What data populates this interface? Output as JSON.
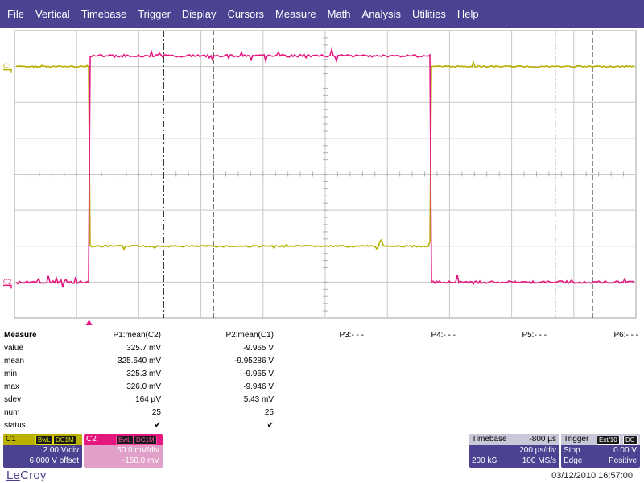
{
  "menu": [
    "File",
    "Vertical",
    "Timebase",
    "Trigger",
    "Display",
    "Cursors",
    "Measure",
    "Math",
    "Analysis",
    "Utilities",
    "Help"
  ],
  "colors": {
    "menubar": "#4b4291",
    "c1": "#b6b100",
    "c2": "#e4177f",
    "cursor": "#000000"
  },
  "waveform": {
    "c1_label": "C1",
    "c2_label": "C2",
    "trigger_marker_icon": "triangle-up-icon",
    "c1_trace": {
      "high_level_div": 3.0,
      "low_level_div": -2.0,
      "fall_time_div": -3.8,
      "rise_time_div": 1.7
    },
    "c2_trace": {
      "low_level_div": -3.0,
      "high_level_div": 3.3,
      "rise_time_div": -3.8,
      "fall_time_div": 1.7
    },
    "cursors_time_div": [
      -2.6,
      3.7,
      -1.8,
      4.3
    ]
  },
  "measure": {
    "title": "Measure",
    "rows": [
      "value",
      "mean",
      "min",
      "max",
      "sdev",
      "num",
      "status"
    ],
    "params": [
      {
        "header": "P1:mean(C2)",
        "values": [
          "325.7 mV",
          "325.640 mV",
          "325.3 mV",
          "326.0 mV",
          "164 µV",
          "25",
          "✔"
        ]
      },
      {
        "header": "P2:mean(C1)",
        "values": [
          "-9.965 V",
          "-9.95286 V",
          "-9.965 V",
          "-9.946 V",
          "5.43 mV",
          "25",
          "✔"
        ]
      },
      {
        "header": "P3:- - -",
        "values": []
      },
      {
        "header": "P4:- - -",
        "values": []
      },
      {
        "header": "P5:- - -",
        "values": []
      },
      {
        "header": "P6:- - -",
        "values": []
      }
    ]
  },
  "c1": {
    "name": "C1",
    "bw": "BwL",
    "coupling": "DC1M",
    "vdiv": "2.00 V/div",
    "offset": "6.000 V offset"
  },
  "c2": {
    "name": "C2",
    "bw": "BwL",
    "coupling": "DC1M",
    "vdiv": "50.0 mV/div",
    "offset": "-150.0 mV"
  },
  "timebase": {
    "title": "Timebase",
    "delay": "-800 µs",
    "tdiv": "200 µs/div",
    "samples": "200 kS",
    "rate": "100 MS/s"
  },
  "trigger": {
    "title": "Trigger",
    "source": "Ext/10",
    "coupling": "DC",
    "mode": "Stop",
    "level": "0.00 V",
    "type": "Edge",
    "slope": "Positive"
  },
  "footer": {
    "logo_le": "Le",
    "logo_rest": "Croy",
    "timestamp": "03/12/2010 16:57:00"
  }
}
